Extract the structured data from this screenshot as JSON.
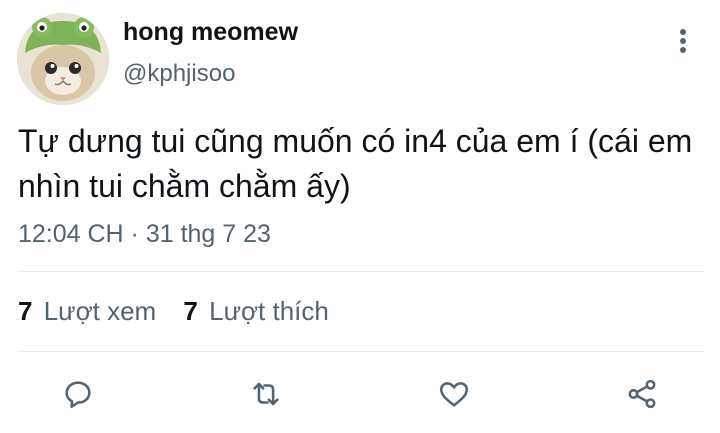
{
  "author": {
    "display_name": "hong meomew",
    "handle": "@kphjisoo",
    "avatar": "cat-in-green-frog-hat-icon"
  },
  "tweet": {
    "text": "Tự dưng tui cũng muốn có in4 của em í (cái em nhìn tui chằm chằm ấy)",
    "timestamp": "12:04 CH · 31 thg 7 23"
  },
  "stats": {
    "views_count": "7",
    "views_label": "Lượt xem",
    "likes_count": "7",
    "likes_label": "Lượt thích"
  },
  "actions": [
    "reply-icon",
    "retweet-icon",
    "like-icon",
    "share-icon"
  ],
  "colors": {
    "text_primary": "#0f1419",
    "text_secondary": "#536471",
    "divider": "#e6ecf0"
  }
}
